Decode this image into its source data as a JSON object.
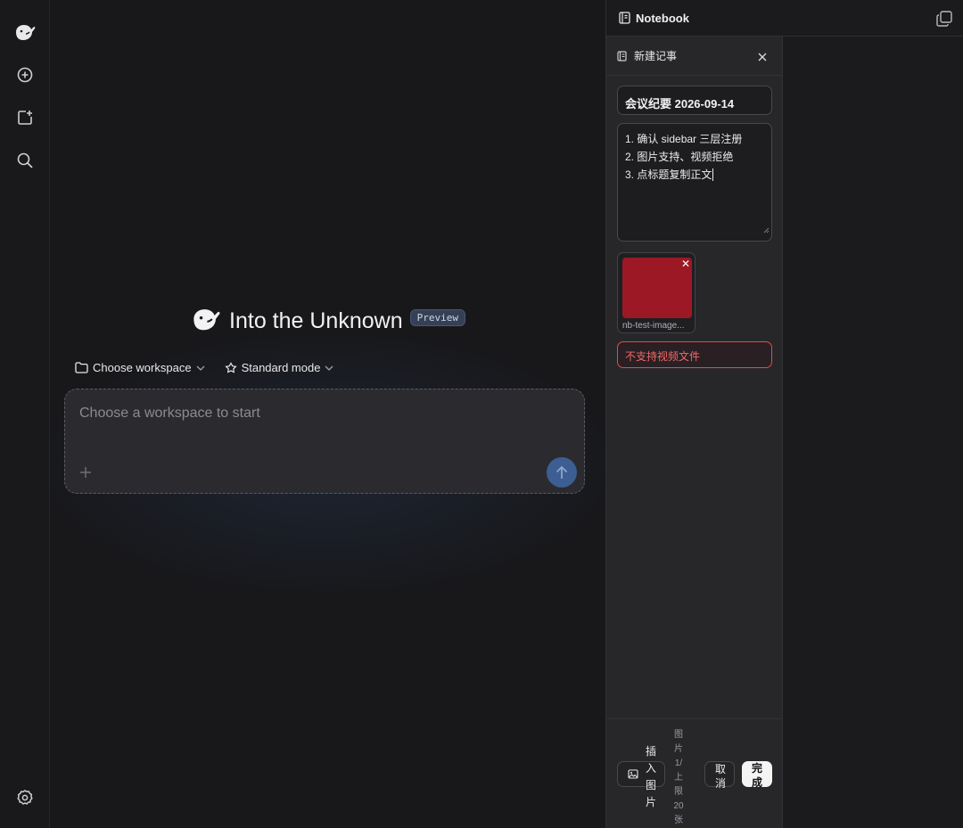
{
  "app": {
    "title": "Into the Unknown",
    "badge": "Preview"
  },
  "rail": {
    "icons": [
      "whale-logo-icon",
      "new-chat-icon",
      "new-project-icon",
      "search-icon",
      "settings-icon"
    ]
  },
  "composer": {
    "workspace_label": "Choose workspace",
    "mode_label": "Standard mode",
    "placeholder": "Choose a workspace to start"
  },
  "notebook": {
    "title": "Notebook",
    "editor": {
      "header": "新建记事",
      "title_value": "会议纪要 2026-09-14",
      "body_lines": [
        "1. 确认 sidebar 三层注册",
        "2. 图片支持、视频拒绝",
        "3. 点标题复制正文"
      ],
      "attachment_name": "nb-test-image...",
      "error": "不支持视频文件",
      "insert_label": "插入图片",
      "image_count": "图片1/上限20张",
      "cancel_label": "取消",
      "done_label": "完成"
    }
  },
  "colors": {
    "accent": "#3c5e93",
    "error": "#e24b4b",
    "attachment": "#9c1824"
  }
}
